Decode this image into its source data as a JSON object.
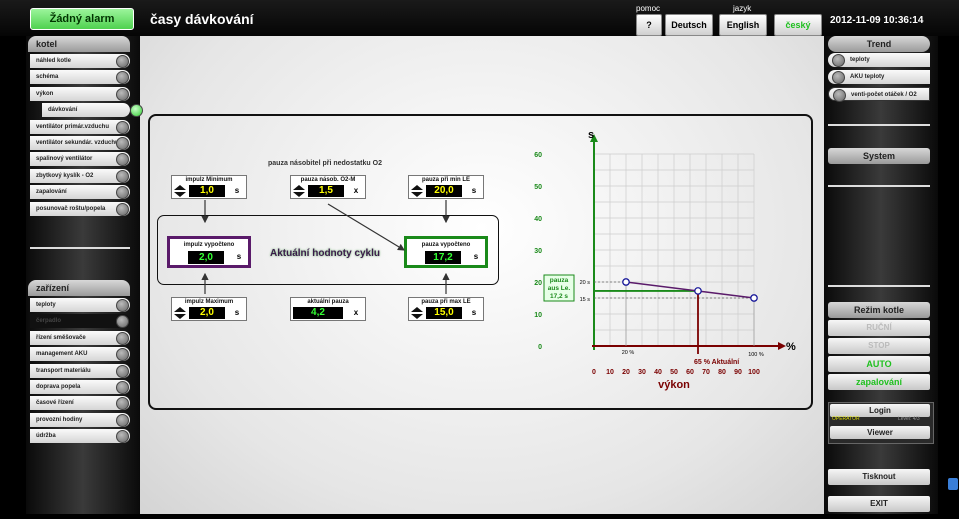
{
  "header": {
    "alarm": "Žádný alarm",
    "title": "časy dávkování",
    "pomoc_label": "pomoc",
    "jazyk_label": "jazyk",
    "help_btn": "?",
    "lang_de": "Deutsch",
    "lang_en": "English",
    "lang_cs": "český",
    "datetime": "2012-11-09 10:36:14"
  },
  "left": {
    "kotel_title": "kotel",
    "kotel_items": [
      "náhled kotle",
      "schéma",
      "výkon",
      "dávkování",
      "ventilátor primár.vzduchu",
      "ventilátor sekundár. vzduchu",
      "spalinový ventilátor",
      "zbytkový kyslík - O2",
      "zapalování",
      "posunovač roštu/popela"
    ],
    "zarizeni_title": "zařízení",
    "zarizeni_items": [
      "teploty",
      "čerpadlo",
      "řízení směšovače",
      "management AKU",
      "transport materiálu",
      "doprava popela",
      "časové řízení",
      "provozní hodiny",
      "údržba"
    ]
  },
  "right": {
    "trend_title": "Trend",
    "trend_items": [
      "teploty",
      "AKU teploty",
      "venti-počet otáček / O2"
    ],
    "system": "System",
    "rezim": "Režim kotle",
    "modes": [
      "RUČNÍ",
      "STOP",
      "AUTO",
      "zapalování"
    ],
    "login": "Login",
    "operator": "OPERATOR",
    "level": "Level: 4/3",
    "viewer": "Viewer",
    "print": "Tisknout",
    "exit": "EXIT"
  },
  "params": {
    "pauza_nasobitel_title": "pauza násobitel při nedostatku O2",
    "impulz_min": {
      "label": "impulz Minimum",
      "value": "1,0",
      "unit": "s"
    },
    "pauza_o2": {
      "label": "pauza násob. O2-M",
      "value": "1,5",
      "unit": "x"
    },
    "pauza_min": {
      "label": "pauza při min LE",
      "value": "20,0",
      "unit": "s"
    },
    "impulz_calc": {
      "label": "impulz vypočteno",
      "value": "2,0",
      "unit": "s"
    },
    "pauza_calc": {
      "label": "pauza vypočteno",
      "value": "17,2",
      "unit": "s"
    },
    "cycle_title": "Aktuální hodnoty cyklu",
    "impulz_max": {
      "label": "impulz Maximum",
      "value": "2,0",
      "unit": "s"
    },
    "akt_pauza": {
      "label": "aktuální pauza",
      "value": "4,2",
      "unit": "x"
    },
    "pauza_max": {
      "label": "pauza při max LE",
      "value": "15,0",
      "unit": "s"
    }
  },
  "chart": {
    "y_unit": "s",
    "x_unit": "%",
    "yticks": [
      "60",
      "50",
      "40",
      "30",
      "20",
      "10",
      "0"
    ],
    "xticks": [
      "0",
      "10",
      "20",
      "30",
      "40",
      "50",
      "60",
      "70",
      "80",
      "90",
      "100"
    ],
    "xlabel": "výkon",
    "pauza_box": [
      "pauza",
      "aus Le.",
      "17,2 s"
    ],
    "lbl_20s": "20 s",
    "lbl_15s": "15 s",
    "lbl_20pct": "20 %",
    "lbl_100pct": "100 %",
    "lbl_aktual": "65  % Aktuální",
    "colors": {
      "axis_y": "#1a8a1a",
      "axis_x": "#7a0000",
      "line": "#5a1a6a",
      "point": "#1a1a9a"
    }
  },
  "chart_data": {
    "type": "line",
    "x": [
      20,
      65,
      100
    ],
    "y": [
      20,
      17.2,
      15
    ],
    "xlabel": "výkon",
    "ylabel": "s",
    "xlim": [
      0,
      100
    ],
    "ylim": [
      0,
      60
    ],
    "grid": true
  }
}
